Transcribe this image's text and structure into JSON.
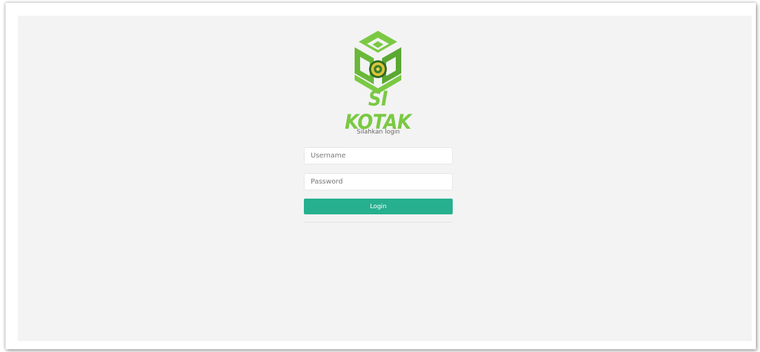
{
  "brand": {
    "logo_text": "SI KOTAK",
    "logo_icon": "green-box-emblem-icon",
    "colors": {
      "logo_green": "#7ac943",
      "logo_dark_green": "#3f8f2a",
      "button": "#26b08f"
    }
  },
  "login": {
    "prompt": "Silahkan login",
    "username_placeholder": "Username",
    "password_placeholder": "Password",
    "button_label": "Login"
  }
}
